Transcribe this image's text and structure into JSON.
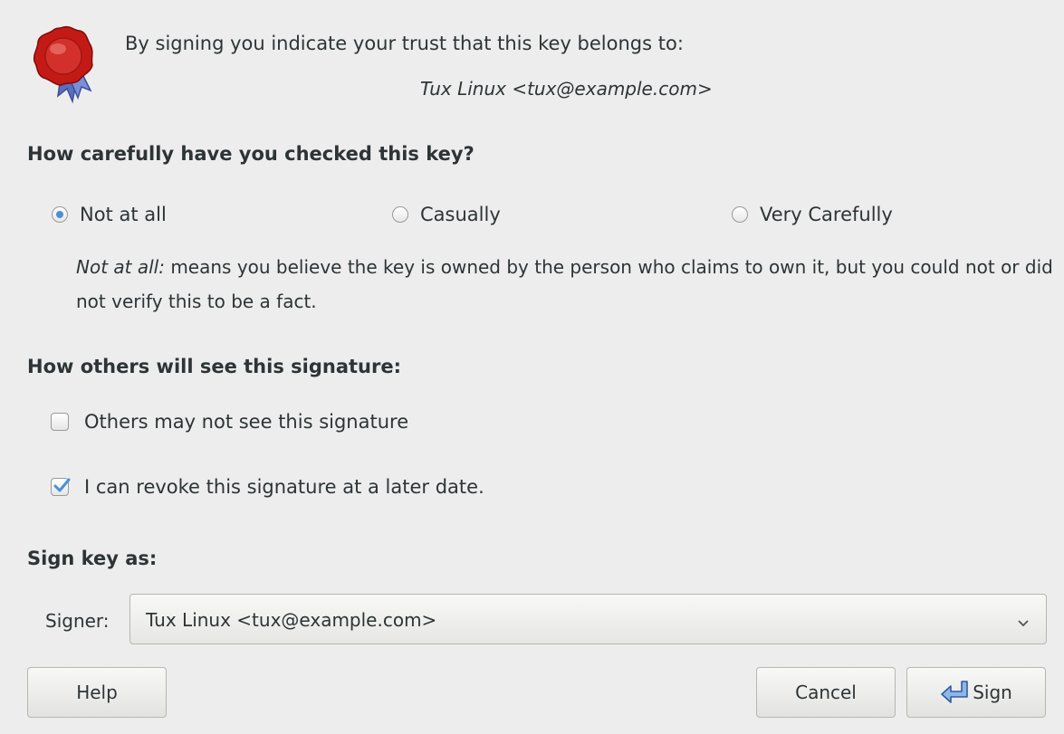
{
  "intro": {
    "text": "By signing you indicate your trust that this key belongs to:",
    "key_owner": "Tux Linux <tux@example.com>",
    "icon": "seal-icon"
  },
  "trust": {
    "heading": "How carefully have you checked this key?",
    "options": [
      {
        "label": "Not at all",
        "checked": true
      },
      {
        "label": "Casually",
        "checked": false
      },
      {
        "label": "Very Carefully",
        "checked": false
      }
    ],
    "description_term": "Not at all:",
    "description_text": " means you believe the key is owned by the person who claims to own it, but you could not or did not verify this to be a fact."
  },
  "visibility": {
    "heading": "How others will see this signature:",
    "options": [
      {
        "label": "Others may not see this signature",
        "checked": false
      },
      {
        "label": "I can revoke this signature at a later date.",
        "checked": true
      }
    ]
  },
  "signer": {
    "heading": "Sign key as:",
    "label": "Signer:",
    "value": "Tux Linux <tux@example.com>"
  },
  "buttons": {
    "help": "Help",
    "cancel": "Cancel",
    "sign": "Sign"
  },
  "colors": {
    "accent": "#4a90d9",
    "seal_red": "#c41a16",
    "background": "#ededed"
  }
}
